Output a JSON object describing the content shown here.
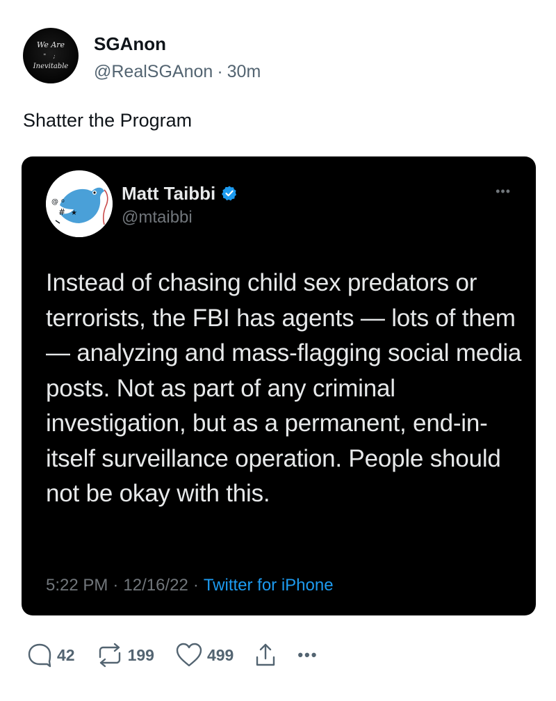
{
  "post": {
    "avatar_text_line1": "We Are",
    "avatar_text_line2": "Inevitable",
    "author_name": "SGAnon",
    "handle": "@RealSGAnon",
    "separator": "·",
    "time": "30m",
    "text": "Shatter the Program"
  },
  "embedded_tweet": {
    "author_name": "Matt Taibbi",
    "handle": "@mtaibbi",
    "verified": true,
    "more_icon": "more-horizontal-icon",
    "body": "Instead of chasing child sex predators or terrorists, the FBI has agents — lots of them — analyzing and mass-flagging social media posts. Not as part of any criminal investigation, but as a permanent, end-in-itself surveillance operation. People should not be okay with this.",
    "time": "5:22 PM",
    "date": "12/16/22",
    "separator": "·",
    "source": "Twitter for iPhone"
  },
  "actions": {
    "replies": "42",
    "reposts": "199",
    "likes": "499",
    "icons": [
      "reply-icon",
      "repost-icon",
      "like-icon",
      "share-icon",
      "more-icon"
    ]
  },
  "colors": {
    "background": "#ffffff",
    "embed_background": "#000000",
    "link_blue": "#1d9bf0",
    "muted_gray": "#536471"
  }
}
